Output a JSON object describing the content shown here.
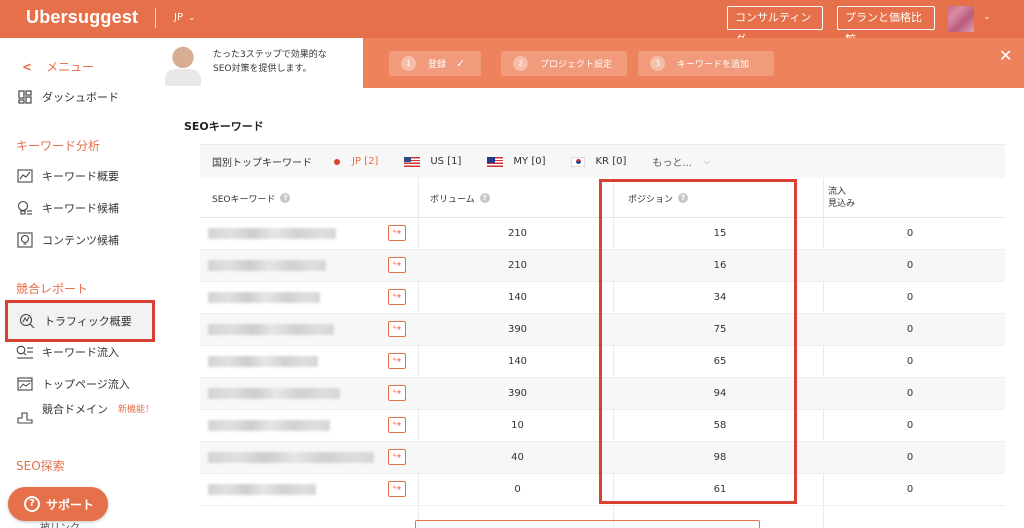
{
  "app": {
    "logo": "Ubersuggest",
    "lang": "JP",
    "consult_label": "コンサルティング",
    "plan_label": "プランと価格比較"
  },
  "sidebar": {
    "back_label": "メニュー",
    "dashboard": "ダッシュボード",
    "keyword_analysis_heading": "キーワード分析",
    "keyword_items": [
      {
        "label": "キーワード概要",
        "icon": "chart-line-icon"
      },
      {
        "label": "キーワード候補",
        "icon": "bulb-icon"
      },
      {
        "label": "コンテンツ候補",
        "icon": "bulb-frame-icon"
      }
    ],
    "competitor_heading": "競合レポート",
    "competitor_items": [
      {
        "label": "トラフィック概要",
        "icon": "gauge-search-icon"
      },
      {
        "label": "キーワード流入",
        "icon": "search-list-icon"
      },
      {
        "label": "トップページ流入",
        "icon": "page-chart-icon"
      },
      {
        "label": "競合ドメイン",
        "icon": "podium-icon",
        "badge": "新機能！"
      }
    ],
    "seo_heading": "SEO探索",
    "partial_item": "被リンク",
    "support_label": "サポート"
  },
  "banner": {
    "text_line1": "たった3ステップで効果的な",
    "text_line2": "SEO対策を提供します。",
    "steps": [
      {
        "num": "1",
        "label": "登録",
        "done": true
      },
      {
        "num": "2",
        "label": "プロジェクト設定",
        "done": false
      },
      {
        "num": "3",
        "label": "キーワードを追加",
        "done": false
      }
    ],
    "close": "✕"
  },
  "main": {
    "section_title": "SEOキーワード",
    "country_label": "国別トップキーワード",
    "countries": [
      {
        "code": "JP",
        "count": "[2]",
        "active": true
      },
      {
        "code": "US",
        "count": "[1]",
        "active": false
      },
      {
        "code": "MY",
        "count": "[0]",
        "active": false
      },
      {
        "code": "KR",
        "count": "[0]",
        "active": false
      }
    ],
    "more_label": "もっと...",
    "columns": {
      "keyword": "SEOキーワード",
      "volume": "ボリューム",
      "position": "ポジション",
      "traffic_line1": "流入",
      "traffic_line2": "見込み"
    },
    "rows": [
      {
        "volume": "210",
        "position": "15",
        "traffic": "0"
      },
      {
        "volume": "210",
        "position": "16",
        "traffic": "0"
      },
      {
        "volume": "140",
        "position": "34",
        "traffic": "0"
      },
      {
        "volume": "390",
        "position": "75",
        "traffic": "0"
      },
      {
        "volume": "140",
        "position": "65",
        "traffic": "0"
      },
      {
        "volume": "390",
        "position": "94",
        "traffic": "0"
      },
      {
        "volume": "10",
        "position": "58",
        "traffic": "0"
      },
      {
        "volume": "40",
        "position": "98",
        "traffic": "0"
      },
      {
        "volume": "0",
        "position": "61",
        "traffic": "0"
      }
    ]
  },
  "colors": {
    "brand": "#e5704a",
    "highlight": "#d94232"
  }
}
